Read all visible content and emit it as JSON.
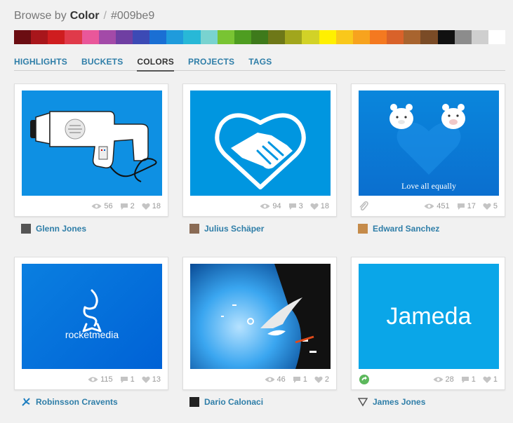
{
  "header": {
    "browse_label": "Browse by",
    "color_label": "Color",
    "separator": "/",
    "hex": "#009be9"
  },
  "palette": [
    "#6b0d12",
    "#a8161b",
    "#cf1d1f",
    "#e03a4a",
    "#e9579a",
    "#a34aa8",
    "#6f3fa2",
    "#3c4ab5",
    "#1a6fd4",
    "#1f9bdc",
    "#28b8d7",
    "#79d3d0",
    "#79c433",
    "#4e9d21",
    "#3e7a1b",
    "#6e7818",
    "#a1a61d",
    "#d2d227",
    "#fff000",
    "#f9c81b",
    "#f7a31e",
    "#f47920",
    "#d9622a",
    "#a8642f",
    "#7a4b26",
    "#111111",
    "#8c8c8c",
    "#cfcfcf",
    "#ffffff"
  ],
  "nav": {
    "tabs": [
      "HIGHLIGHTS",
      "BUCKETS",
      "COLORS",
      "PROJECTS",
      "TAGS"
    ],
    "active": "COLORS"
  },
  "shots": [
    {
      "author": "Glenn Jones",
      "views": "56",
      "comments": "2",
      "likes": "18"
    },
    {
      "author": "Julius Schäper",
      "views": "94",
      "comments": "3",
      "likes": "18"
    },
    {
      "author": "Edward Sanchez",
      "views": "451",
      "comments": "17",
      "likes": "5",
      "caption": "Love all equally"
    },
    {
      "author": "Robinsson Cravents",
      "views": "115",
      "comments": "1",
      "likes": "13",
      "brand": "rocketmedia"
    },
    {
      "author": "Dario Calonaci",
      "views": "46",
      "comments": "1",
      "likes": "2"
    },
    {
      "author": "James Jones",
      "views": "28",
      "comments": "1",
      "likes": "1",
      "brand": "Jameda"
    }
  ],
  "icons": {
    "views": "eye-icon",
    "comments": "comment-icon",
    "likes": "heart-icon",
    "attachment": "paperclip-icon",
    "rebound": "rebound-icon"
  }
}
